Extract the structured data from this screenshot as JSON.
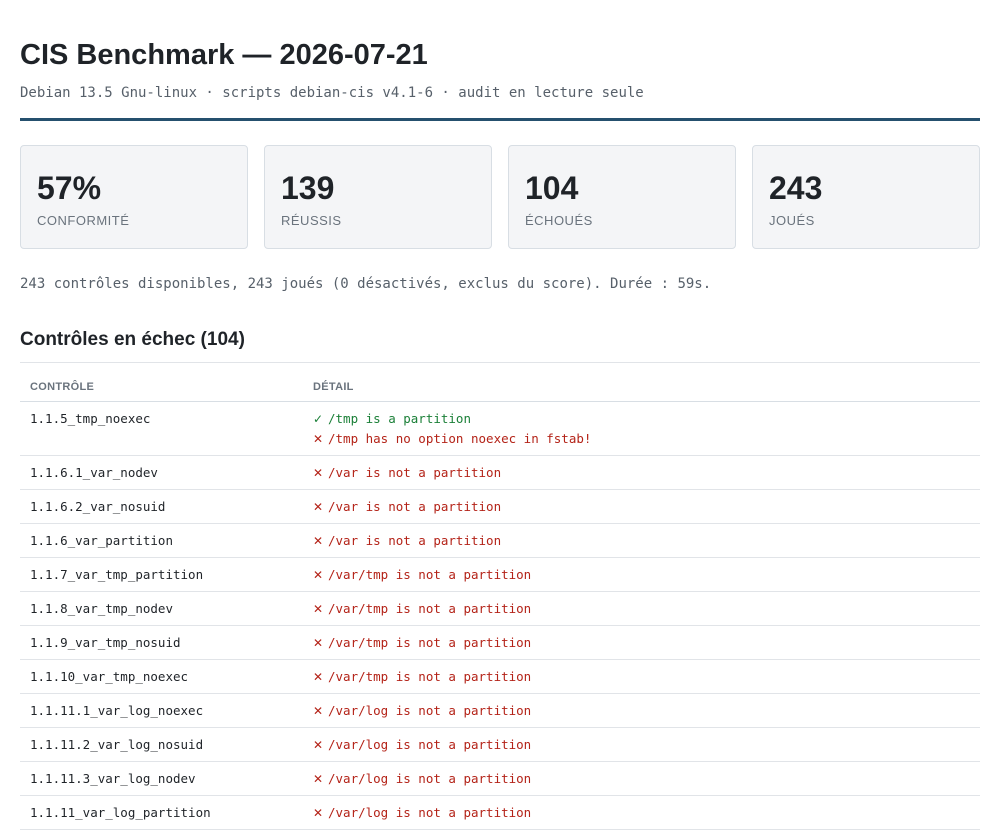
{
  "header": {
    "title": "CIS Benchmark — 2026-07-21",
    "subtitle": "Debian 13.5 Gnu-linux · scripts debian-cis v4.1-6 · audit en lecture seule"
  },
  "colors": {
    "accent_rule": "#25506e",
    "pass": "#1a7f37",
    "fail": "#b42318"
  },
  "stats": [
    {
      "value": "57%",
      "label": "Conformité"
    },
    {
      "value": "139",
      "label": "Réussis"
    },
    {
      "value": "104",
      "label": "Échoués"
    },
    {
      "value": "243",
      "label": "Joués"
    }
  ],
  "summary": "243 contrôles disponibles, 243 joués (0 désactivés, exclus du score). Durée : 59s.",
  "failed_section": {
    "title": "Contrôles en échec (104)",
    "columns": [
      "Contrôle",
      "Détail"
    ],
    "rows": [
      {
        "control": "1.1.5_tmp_noexec",
        "details": [
          {
            "status": "ok",
            "icon": "check-icon",
            "text": "/tmp is a partition"
          },
          {
            "status": "ko",
            "icon": "cross-icon",
            "text": "/tmp has no option noexec in fstab!"
          }
        ]
      },
      {
        "control": "1.1.6.1_var_nodev",
        "details": [
          {
            "status": "ko",
            "icon": "cross-icon",
            "text": "/var is not a partition"
          }
        ]
      },
      {
        "control": "1.1.6.2_var_nosuid",
        "details": [
          {
            "status": "ko",
            "icon": "cross-icon",
            "text": "/var is not a partition"
          }
        ]
      },
      {
        "control": "1.1.6_var_partition",
        "details": [
          {
            "status": "ko",
            "icon": "cross-icon",
            "text": "/var is not a partition"
          }
        ]
      },
      {
        "control": "1.1.7_var_tmp_partition",
        "details": [
          {
            "status": "ko",
            "icon": "cross-icon",
            "text": "/var/tmp is not a partition"
          }
        ]
      },
      {
        "control": "1.1.8_var_tmp_nodev",
        "details": [
          {
            "status": "ko",
            "icon": "cross-icon",
            "text": "/var/tmp is not a partition"
          }
        ]
      },
      {
        "control": "1.1.9_var_tmp_nosuid",
        "details": [
          {
            "status": "ko",
            "icon": "cross-icon",
            "text": "/var/tmp is not a partition"
          }
        ]
      },
      {
        "control": "1.1.10_var_tmp_noexec",
        "details": [
          {
            "status": "ko",
            "icon": "cross-icon",
            "text": "/var/tmp is not a partition"
          }
        ]
      },
      {
        "control": "1.1.11.1_var_log_noexec",
        "details": [
          {
            "status": "ko",
            "icon": "cross-icon",
            "text": "/var/log is not a partition"
          }
        ]
      },
      {
        "control": "1.1.11.2_var_log_nosuid",
        "details": [
          {
            "status": "ko",
            "icon": "cross-icon",
            "text": "/var/log is not a partition"
          }
        ]
      },
      {
        "control": "1.1.11.3_var_log_nodev",
        "details": [
          {
            "status": "ko",
            "icon": "cross-icon",
            "text": "/var/log is not a partition"
          }
        ]
      },
      {
        "control": "1.1.11_var_log_partition",
        "details": [
          {
            "status": "ko",
            "icon": "cross-icon",
            "text": "/var/log is not a partition"
          }
        ]
      }
    ]
  }
}
